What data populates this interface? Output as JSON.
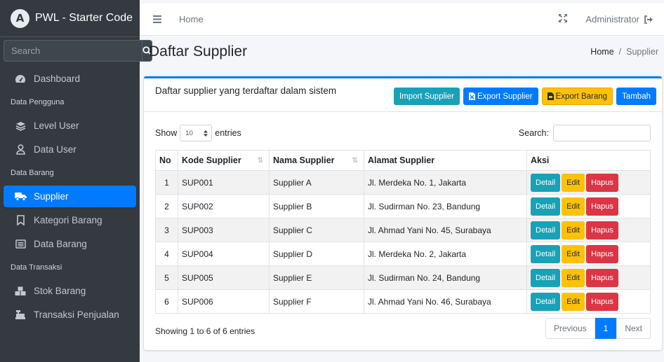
{
  "brand": {
    "title": "PWL - Starter Code",
    "logo_letter": "A"
  },
  "sidebar": {
    "search_placeholder": "Search",
    "items": [
      {
        "type": "item",
        "label": "Dashboard",
        "icon": "tachometer-icon"
      },
      {
        "type": "header",
        "label": "Data Pengguna"
      },
      {
        "type": "item",
        "label": "Level User",
        "icon": "layers-icon"
      },
      {
        "type": "item",
        "label": "Data User",
        "icon": "user-icon"
      },
      {
        "type": "header",
        "label": "Data Barang"
      },
      {
        "type": "item",
        "label": "Supplier",
        "icon": "truck-icon",
        "active": true
      },
      {
        "type": "item",
        "label": "Kategori Barang",
        "icon": "bookmark-icon"
      },
      {
        "type": "item",
        "label": "Data Barang",
        "icon": "list-icon"
      },
      {
        "type": "header",
        "label": "Data Transaksi"
      },
      {
        "type": "item",
        "label": "Stok Barang",
        "icon": "cubes-icon"
      },
      {
        "type": "item",
        "label": "Transaksi Penjualan",
        "icon": "cash-register-icon"
      }
    ]
  },
  "topbar": {
    "home": "Home",
    "user": "Administrator"
  },
  "page": {
    "title": "Daftar Supplier",
    "breadcrumb": [
      "Home",
      "Supplier"
    ]
  },
  "card": {
    "title": "Daftar supplier yang terdaftar dalam sistem",
    "buttons": {
      "import": "Import Supplier",
      "export_supplier": "Export Supplier",
      "export_barang": "Export Barang",
      "add": "Tambah"
    }
  },
  "table": {
    "show_label": "Show",
    "entries_label": "entries",
    "page_length": "10",
    "search_label": "Search:",
    "columns": [
      "No",
      "Kode Supplier",
      "Nama Supplier",
      "Alamat Supplier",
      "Aksi"
    ],
    "rows": [
      [
        "1",
        "SUP001",
        "Supplier A",
        "Jl. Merdeka No. 1, Jakarta"
      ],
      [
        "2",
        "SUP002",
        "Supplier B",
        "Jl. Sudirman No. 23, Bandung"
      ],
      [
        "3",
        "SUP003",
        "Supplier C",
        "Jl. Ahmad Yani No. 45, Surabaya"
      ],
      [
        "4",
        "SUP004",
        "Supplier D",
        "Jl. Merdeka No. 2, Jakarta"
      ],
      [
        "5",
        "SUP005",
        "Supplier E",
        "Jl. Sudirman No. 24, Bandung"
      ],
      [
        "6",
        "SUP006",
        "Supplier F",
        "Jl. Ahmad Yani No. 46, Surabaya"
      ]
    ],
    "actions": {
      "detail": "Detail",
      "edit": "Edit",
      "delete": "Hapus"
    },
    "info": "Showing 1 to 6 of 6 entries",
    "pagination": {
      "previous": "Previous",
      "current": "1",
      "next": "Next"
    }
  }
}
